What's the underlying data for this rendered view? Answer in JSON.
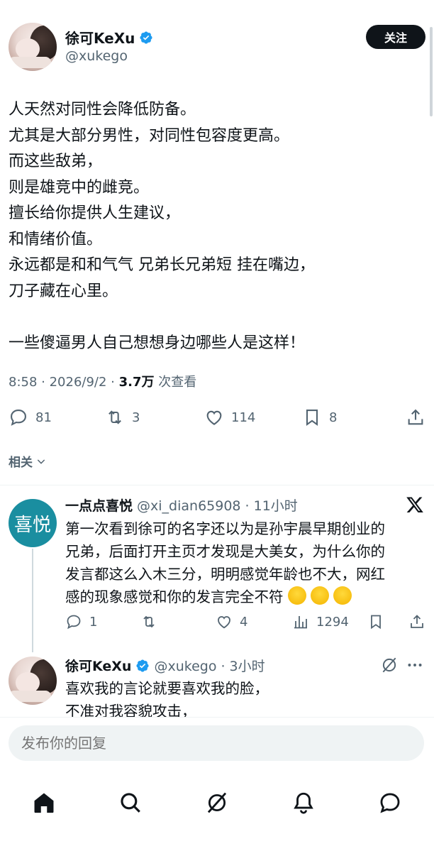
{
  "post": {
    "display_name": "徐可KeXu",
    "handle": "@xukego",
    "follow_label": "关注",
    "lines": [
      "人天然对同性会降低防备。",
      "尤其是大部分男性，对同性包容度更高。",
      "而这些敌弟，",
      "则是雄竞中的雌竞。",
      "擅长给你提供人生建议，",
      "和情绪价值。",
      "永远都是和和气气 兄弟长兄弟短 挂在嘴边，",
      "刀子藏在心里。",
      "",
      "一些傻逼男人自己想想身边哪些人是这样！"
    ],
    "timestamp": "8:58 · 2026/9/2 · ",
    "views_count": "3.7万",
    "views_label": " 次查看",
    "stats": {
      "replies": "81",
      "reposts": "3",
      "likes": "114",
      "bookmarks": "8"
    }
  },
  "related_label": "相关",
  "reply1": {
    "avatar_text": "喜悦",
    "display_name": "一点点喜悦",
    "handle_time": "@xi_dian65908 · 11小时",
    "lines": [
      "第一次看到徐可的名字还以为是孙宇晨早期创业的",
      "兄弟，后面打开主页才发现是大美女，为什么你的",
      "发言都这么入木三分，明明感觉年龄也不大，网红",
      "感的现象感觉和你的发言完全不符"
    ],
    "stats": {
      "replies": "1",
      "likes": "4",
      "views": "1294"
    }
  },
  "reply2": {
    "display_name": "徐可KeXu",
    "handle_time": "@xukego · 3小时",
    "lines": [
      "喜欢我的言论就要喜欢我的脸，",
      "不准对我容貌攻击，"
    ]
  },
  "compose": {
    "placeholder": "发布你的回复"
  },
  "colors": {
    "verified": "#1d9bf0",
    "avatar_teal": "#1a8ea0",
    "text_secondary": "#536471"
  },
  "icons": [
    "verified-icon",
    "reply-icon",
    "repost-icon",
    "like-icon",
    "bookmark-icon",
    "share-icon",
    "chevron-down-icon",
    "x-logo-icon",
    "views-icon",
    "grok-icon",
    "more-icon",
    "home-icon",
    "search-icon",
    "notifications-icon",
    "messages-icon",
    "laughing-emoji-icon"
  ]
}
